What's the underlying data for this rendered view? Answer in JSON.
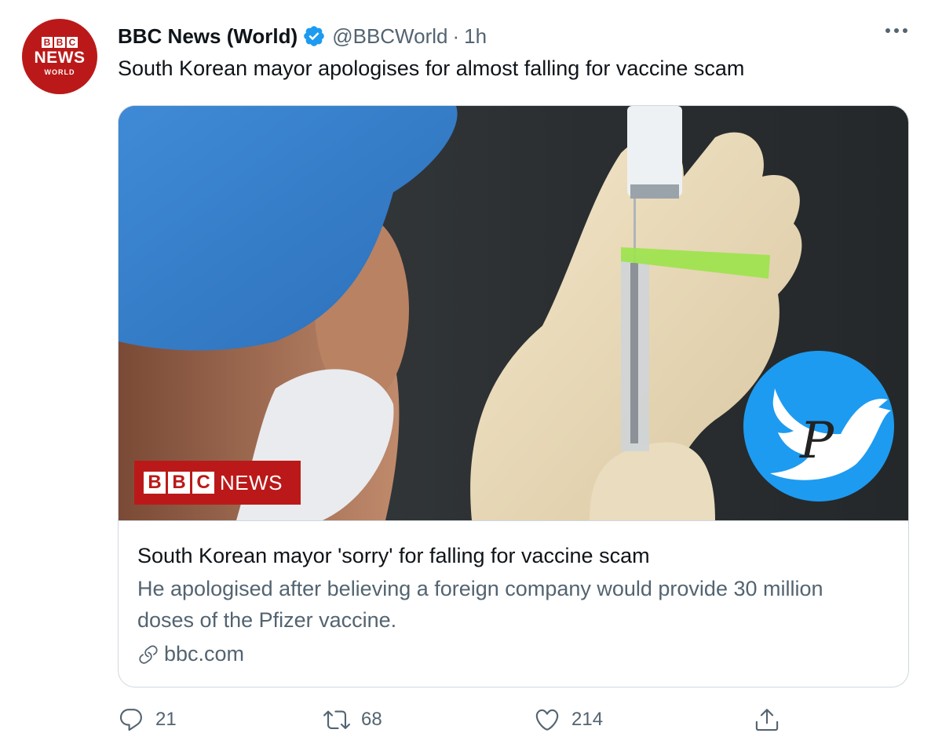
{
  "account": {
    "avatar_blocks": [
      "B",
      "B",
      "C"
    ],
    "avatar_news": "NEWS",
    "avatar_world": "WORLD",
    "name": "BBC News (World)",
    "handle": "@BBCWorld",
    "separator": "·",
    "time": "1h"
  },
  "tweet": {
    "text": "South Korean mayor apologises for almost falling for vaccine scam"
  },
  "card": {
    "badge_blocks": [
      "B",
      "B",
      "C"
    ],
    "badge_news": "NEWS",
    "watermark_letter": "P",
    "title": "South Korean mayor 'sorry' for falling for vaccine scam",
    "description": "He apologised after believing a foreign company would provide 30 million doses of the Pfizer vaccine.",
    "domain": "bbc.com"
  },
  "actions": {
    "reply_count": "21",
    "retweet_count": "68",
    "like_count": "214"
  },
  "icons": {
    "verified": "verified-badge-icon",
    "more": "more-horizontal-icon",
    "link": "link-icon",
    "reply": "reply-icon",
    "retweet": "retweet-icon",
    "like": "heart-icon",
    "share": "share-icon",
    "watermark": "twitter-bird-icon"
  },
  "colors": {
    "bbc_red": "#bb1919",
    "twitter_blue": "#1d9bf0",
    "text_secondary": "#536471"
  }
}
